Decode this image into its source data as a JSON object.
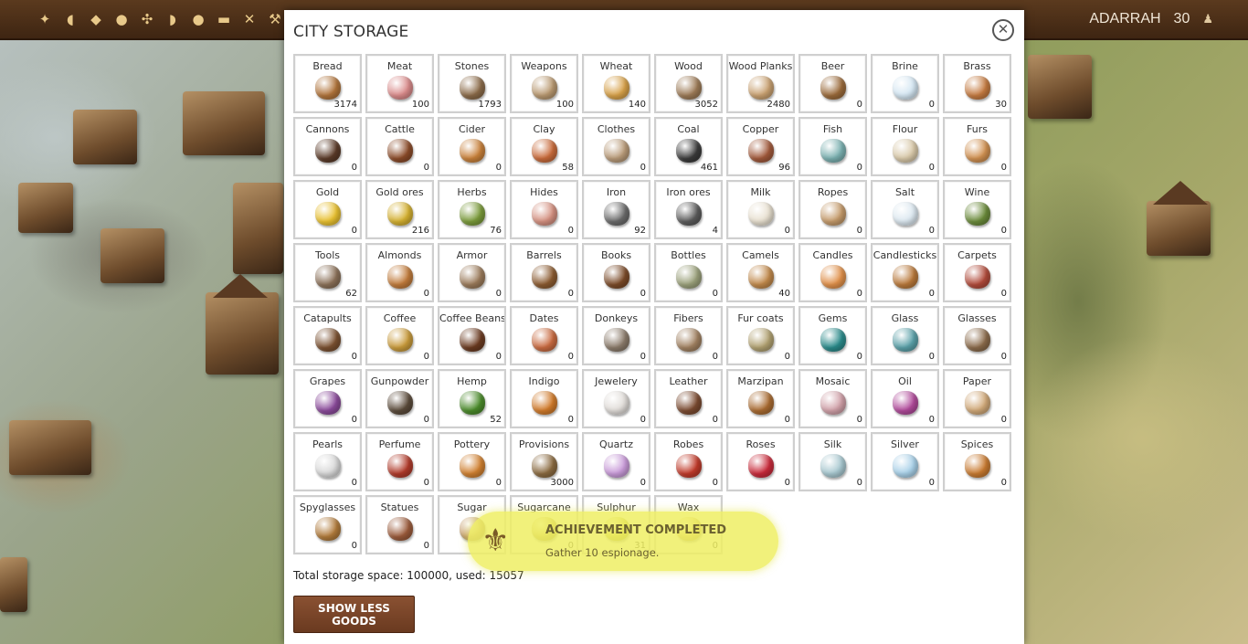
{
  "resource_bar": [
    "gold-ore-icon",
    "meat-icon",
    "stones-icon",
    "cattle-icon",
    "tools-icon",
    "almonds-icon",
    "dates-icon",
    "wood-planks-icon",
    "weapons-icon",
    "hammer-icon"
  ],
  "resource_glyphs": [
    "✦",
    "◖",
    "◆",
    "●",
    "✣",
    "◗",
    "●",
    "▬",
    "✕",
    "⚒"
  ],
  "player": {
    "name": "ADARRAH",
    "level": "30",
    "icon": "peasant-icon"
  },
  "modal": {
    "title": "CITY STORAGE",
    "close_glyph": "✕",
    "goods": [
      {
        "name": "Bread",
        "amount": "3174",
        "color": "#b0733a"
      },
      {
        "name": "Meat",
        "amount": "100",
        "color": "#d98a8a"
      },
      {
        "name": "Stones",
        "amount": "1793",
        "color": "#8a6a48"
      },
      {
        "name": "Weapons",
        "amount": "100",
        "color": "#b89870"
      },
      {
        "name": "Wheat",
        "amount": "140",
        "color": "#d6a048"
      },
      {
        "name": "Wood",
        "amount": "3052",
        "color": "#9c7a56"
      },
      {
        "name": "Wood Planks",
        "amount": "2480",
        "color": "#c8a070"
      },
      {
        "name": "Beer",
        "amount": "0",
        "color": "#9a6a3a"
      },
      {
        "name": "Brine",
        "amount": "0",
        "color": "#d4e6f2"
      },
      {
        "name": "Brass",
        "amount": "30",
        "color": "#c47a40"
      },
      {
        "name": "Cannons",
        "amount": "0",
        "color": "#5a3a28"
      },
      {
        "name": "Cattle",
        "amount": "0",
        "color": "#8a4a28"
      },
      {
        "name": "Cider",
        "amount": "0",
        "color": "#c8803a"
      },
      {
        "name": "Clay",
        "amount": "58",
        "color": "#c86a3a"
      },
      {
        "name": "Clothes",
        "amount": "0",
        "color": "#b89a78"
      },
      {
        "name": "Coal",
        "amount": "461",
        "color": "#3a3a3a"
      },
      {
        "name": "Copper",
        "amount": "96",
        "color": "#a0583a"
      },
      {
        "name": "Fish",
        "amount": "0",
        "color": "#7ab0b0"
      },
      {
        "name": "Flour",
        "amount": "0",
        "color": "#d8c8a8"
      },
      {
        "name": "Furs",
        "amount": "0",
        "color": "#d09050"
      },
      {
        "name": "Gold",
        "amount": "0",
        "color": "#e8c030"
      },
      {
        "name": "Gold ores",
        "amount": "216",
        "color": "#d4b030"
      },
      {
        "name": "Herbs",
        "amount": "76",
        "color": "#7a9a3a"
      },
      {
        "name": "Hides",
        "amount": "0",
        "color": "#d49080"
      },
      {
        "name": "Iron",
        "amount": "92",
        "color": "#6a6a6a"
      },
      {
        "name": "Iron ores",
        "amount": "4",
        "color": "#5a5a5a"
      },
      {
        "name": "Milk",
        "amount": "0",
        "color": "#e8e0d0"
      },
      {
        "name": "Ropes",
        "amount": "0",
        "color": "#c49a6a"
      },
      {
        "name": "Salt",
        "amount": "0",
        "color": "#dce8f0"
      },
      {
        "name": "Wine",
        "amount": "0",
        "color": "#6a8a3a"
      },
      {
        "name": "Tools",
        "amount": "62",
        "color": "#8a7058"
      },
      {
        "name": "Almonds",
        "amount": "0",
        "color": "#c07a3a"
      },
      {
        "name": "Armor",
        "amount": "0",
        "color": "#9a7a5a"
      },
      {
        "name": "Barrels",
        "amount": "0",
        "color": "#8a5a30"
      },
      {
        "name": "Books",
        "amount": "0",
        "color": "#7a4a28"
      },
      {
        "name": "Bottles",
        "amount": "0",
        "color": "#9aa07a"
      },
      {
        "name": "Camels",
        "amount": "40",
        "color": "#c0884a"
      },
      {
        "name": "Candles",
        "amount": "0",
        "color": "#e0904a"
      },
      {
        "name": "Candlesticks",
        "amount": "0",
        "color": "#b8783a"
      },
      {
        "name": "Carpets",
        "amount": "0",
        "color": "#b04a3a"
      },
      {
        "name": "Catapults",
        "amount": "0",
        "color": "#7a5030"
      },
      {
        "name": "Coffee",
        "amount": "0",
        "color": "#c89a3a"
      },
      {
        "name": "Coffee Beans",
        "amount": "0",
        "color": "#6a3a20"
      },
      {
        "name": "Dates",
        "amount": "0",
        "color": "#c86a40"
      },
      {
        "name": "Donkeys",
        "amount": "0",
        "color": "#8a7a6a"
      },
      {
        "name": "Fibers",
        "amount": "0",
        "color": "#a08060"
      },
      {
        "name": "Fur coats",
        "amount": "0",
        "color": "#b0a070"
      },
      {
        "name": "Gems",
        "amount": "0",
        "color": "#2a8a8a"
      },
      {
        "name": "Glass",
        "amount": "0",
        "color": "#5aa0a8"
      },
      {
        "name": "Glasses",
        "amount": "0",
        "color": "#8a6a4a"
      },
      {
        "name": "Grapes",
        "amount": "0",
        "color": "#8a4a9a"
      },
      {
        "name": "Gunpowder",
        "amount": "0",
        "color": "#5a4a3a"
      },
      {
        "name": "Hemp",
        "amount": "52",
        "color": "#4a8a2a"
      },
      {
        "name": "Indigo",
        "amount": "0",
        "color": "#d07a2a"
      },
      {
        "name": "Jewelery",
        "amount": "0",
        "color": "#e0dcd8"
      },
      {
        "name": "Leather",
        "amount": "0",
        "color": "#7a4a30"
      },
      {
        "name": "Marzipan",
        "amount": "0",
        "color": "#a86a30"
      },
      {
        "name": "Mosaic",
        "amount": "0",
        "color": "#d0a0a8"
      },
      {
        "name": "Oil",
        "amount": "0",
        "color": "#b04a9a"
      },
      {
        "name": "Paper",
        "amount": "0",
        "color": "#d0a878"
      },
      {
        "name": "Pearls",
        "amount": "0",
        "color": "#d8d8d8"
      },
      {
        "name": "Perfume",
        "amount": "0",
        "color": "#b03a2a"
      },
      {
        "name": "Pottery",
        "amount": "0",
        "color": "#d08030"
      },
      {
        "name": "Provisions",
        "amount": "3000",
        "color": "#8a6a40"
      },
      {
        "name": "Quartz",
        "amount": "0",
        "color": "#c89ad8"
      },
      {
        "name": "Robes",
        "amount": "0",
        "color": "#c03a2a"
      },
      {
        "name": "Roses",
        "amount": "0",
        "color": "#c82a3a"
      },
      {
        "name": "Silk",
        "amount": "0",
        "color": "#a8c8d0"
      },
      {
        "name": "Silver",
        "amount": "0",
        "color": "#a8d0e8"
      },
      {
        "name": "Spices",
        "amount": "0",
        "color": "#c87a30"
      },
      {
        "name": "Spyglasses",
        "amount": "0",
        "color": "#b07a3a"
      },
      {
        "name": "Statues",
        "amount": "0",
        "color": "#9a5a3a"
      },
      {
        "name": "Sugar",
        "amount": "0",
        "color": "#c8a070"
      },
      {
        "name": "Sugarcane",
        "amount": "0",
        "color": "#c8b050"
      },
      {
        "name": "Sulphur",
        "amount": "31",
        "color": "#c8c030"
      },
      {
        "name": "Wax",
        "amount": "0",
        "color": "#e0c060"
      }
    ],
    "summary": "Total storage space: 100000, used: 15057",
    "toggle_button_label": "SHOW LESS GOODS"
  },
  "achievement": {
    "title": "ACHIEVEMENT COMPLETED",
    "message": "Gather 10 espionage.",
    "icon": "fleur-de-lis-icon",
    "icon_glyph": "⚜"
  }
}
